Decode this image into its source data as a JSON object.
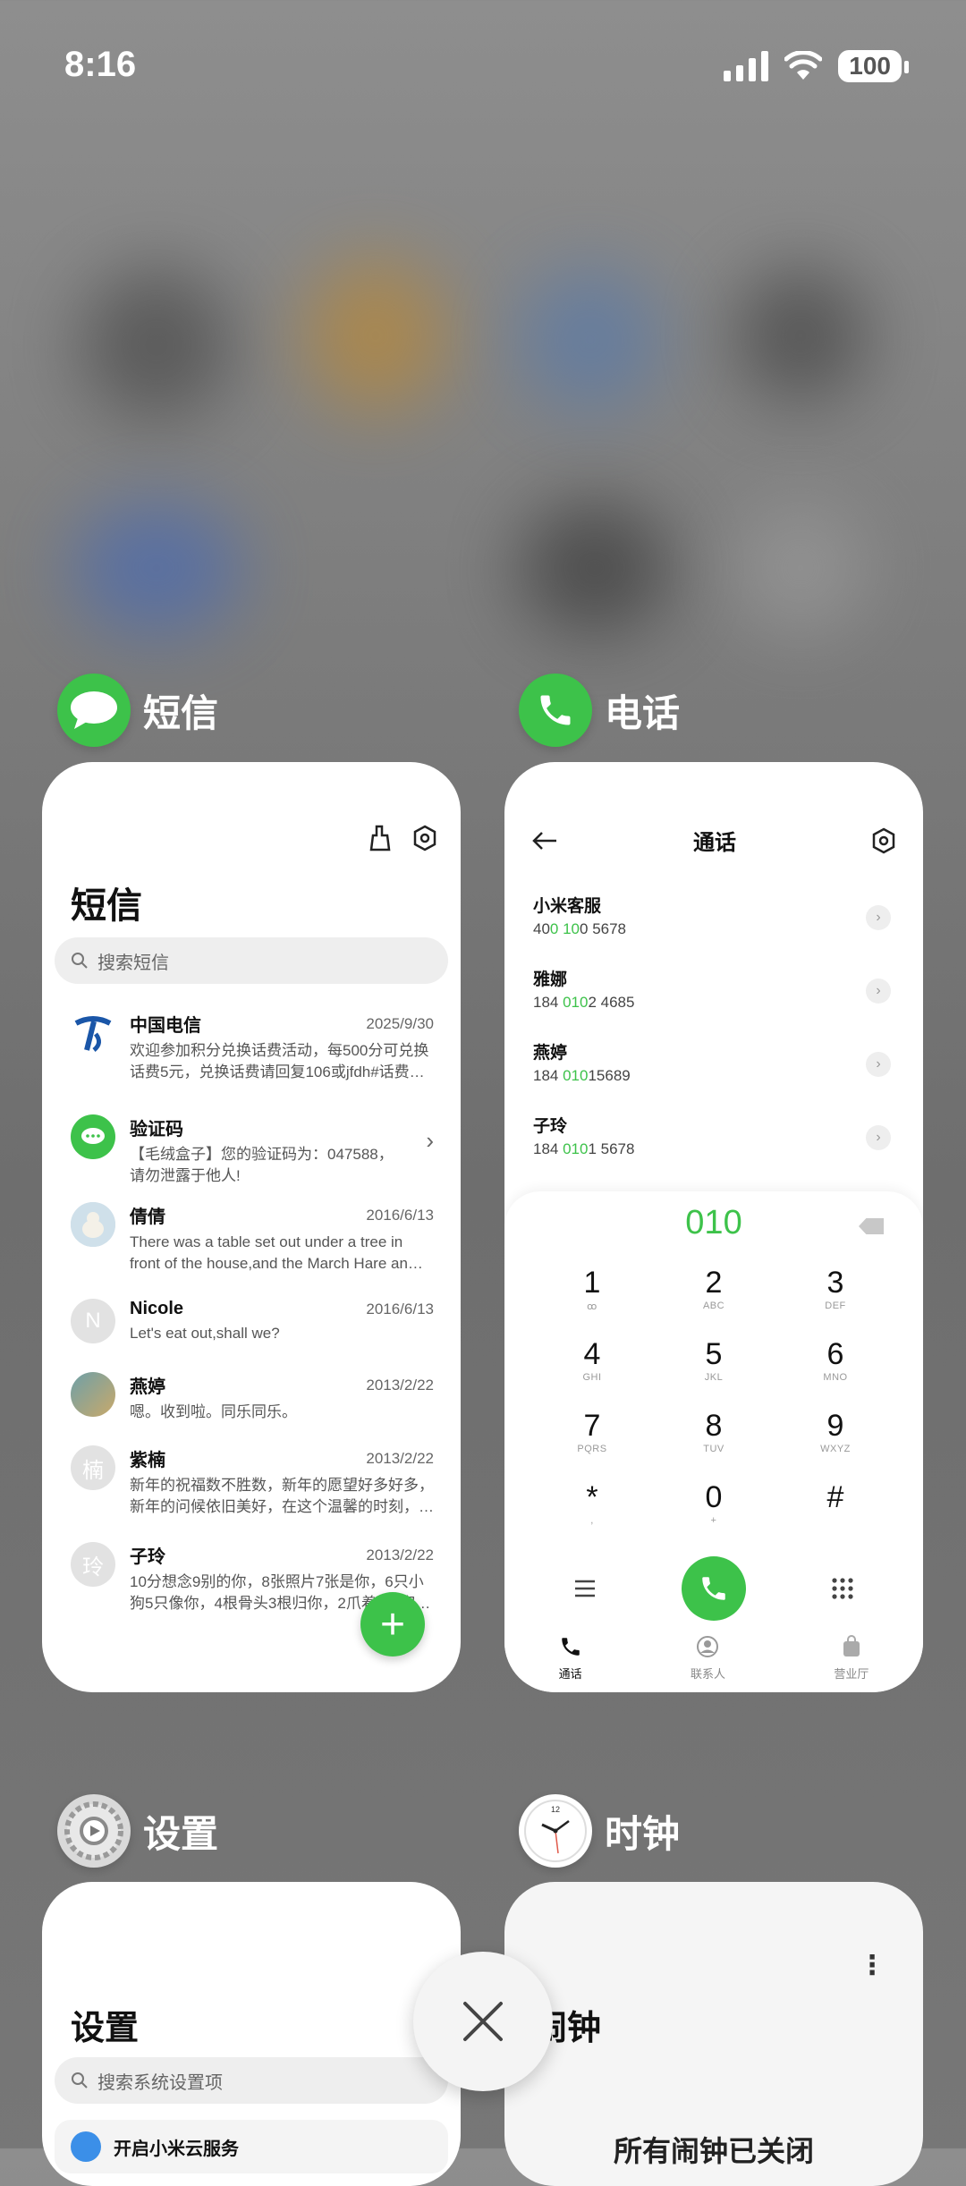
{
  "status_bar": {
    "time": "8:16",
    "battery": "100"
  },
  "apps": {
    "messages": {
      "label": "短信",
      "title": "短信",
      "search_placeholder": "搜索短信",
      "items": [
        {
          "name": "中国电信",
          "date": "2025/9/30",
          "preview": "欢迎参加积分兑换话费活动，每500分可兑换话费5元，兑换话费请回复106或jfdh#话费…",
          "avatar": "",
          "avatar_color": "#ffffff"
        },
        {
          "name": "验证码",
          "date": "",
          "preview": "【毛绒盒子】您的验证码为：047588，请勿泄露于他人!",
          "avatar": "",
          "avatar_color": "#3dc24a"
        },
        {
          "name": "倩倩",
          "date": "2016/6/13",
          "preview": "There was a table set out under a tree in front of the house,and the March Hare an…",
          "avatar": "",
          "avatar_color": "#c9d6e0"
        },
        {
          "name": "Nicole",
          "date": "2016/6/13",
          "preview": "Let's eat out,shall we?",
          "avatar": "N",
          "avatar_color": "#e2e2e2"
        },
        {
          "name": "燕婷",
          "date": "2013/2/22",
          "preview": "嗯。收到啦。同乐同乐。",
          "avatar": "",
          "avatar_color": "#7a9a8a"
        },
        {
          "name": "紫楠",
          "date": "2013/2/22",
          "preview": "新年的祝福数不胜数，新年的愿望好多好多，新年的问候依旧美好，在这个温馨的时刻，…",
          "avatar": "楠",
          "avatar_color": "#e2e2e2"
        },
        {
          "name": "子玲",
          "date": "2013/2/22",
          "preview": "10分想念9别的你，8张照片7张是你，6只小狗5只像你，4根骨头3根归你，2爪着地1家…",
          "avatar": "玲",
          "avatar_color": "#e2e2e2"
        }
      ]
    },
    "phone": {
      "label": "电话",
      "title": "通话",
      "contacts": [
        {
          "name": "小米客服",
          "pre": "40",
          "hl": "0 10",
          "post": "0 5678"
        },
        {
          "name": "雅娜",
          "pre": "184 ",
          "hl": "010",
          "post": "2 4685"
        },
        {
          "name": "燕婷",
          "pre": "184 ",
          "hl": "010",
          "post": "15689"
        },
        {
          "name": "子玲",
          "pre": "184 ",
          "hl": "010",
          "post": "1 5678"
        }
      ],
      "dial_input": "010",
      "keys": [
        {
          "d": "1",
          "l": "ꝏ"
        },
        {
          "d": "2",
          "l": "ABC"
        },
        {
          "d": "3",
          "l": "DEF"
        },
        {
          "d": "4",
          "l": "GHI"
        },
        {
          "d": "5",
          "l": "JKL"
        },
        {
          "d": "6",
          "l": "MNO"
        },
        {
          "d": "7",
          "l": "PQRS"
        },
        {
          "d": "8",
          "l": "TUV"
        },
        {
          "d": "9",
          "l": "WXYZ"
        },
        {
          "d": "*",
          "l": ","
        },
        {
          "d": "0",
          "l": "+"
        },
        {
          "d": "#",
          "l": ""
        }
      ],
      "nav": [
        "通话",
        "联系人",
        "营业厅"
      ]
    },
    "settings": {
      "label": "设置",
      "title": "设置",
      "search_placeholder": "搜索系统设置项",
      "first_item": "开启小米云服务"
    },
    "clock": {
      "label": "时钟",
      "title": "闹钟",
      "status": "所有闹钟已关闭"
    }
  },
  "colors": {
    "accent": "#3dc24a"
  }
}
